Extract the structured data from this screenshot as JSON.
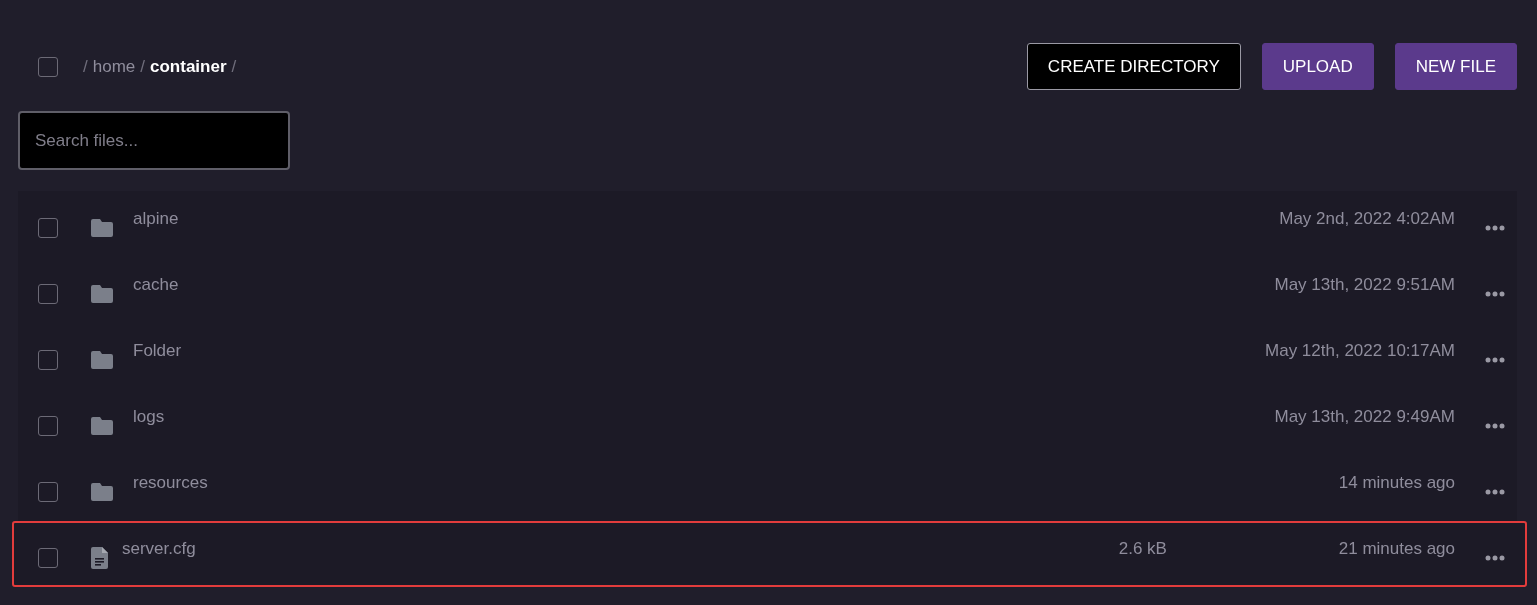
{
  "breadcrumb": {
    "checked": false,
    "separators": [
      "/",
      "/",
      "/"
    ],
    "segments": [
      {
        "label": "home",
        "current": false
      },
      {
        "label": "container",
        "current": true
      }
    ]
  },
  "buttons": [
    {
      "label": "CREATE DIRECTORY",
      "kind": "outline"
    },
    {
      "label": "UPLOAD",
      "kind": "primary"
    },
    {
      "label": "NEW FILE",
      "kind": "primary"
    }
  ],
  "search": {
    "placeholder": "Search files..."
  },
  "files": [
    {
      "name": "alpine",
      "kind": "folder",
      "modified": "May 2nd, 2022 4:02AM",
      "checked": false,
      "highlighted": false
    },
    {
      "name": "cache",
      "kind": "folder",
      "modified": "May 13th, 2022 9:51AM",
      "checked": false,
      "highlighted": false
    },
    {
      "name": "Folder",
      "kind": "folder",
      "modified": "May 12th, 2022 10:17AM",
      "checked": false,
      "highlighted": false
    },
    {
      "name": "logs",
      "kind": "folder",
      "modified": "May 13th, 2022 9:49AM",
      "checked": false,
      "highlighted": false
    },
    {
      "name": "resources",
      "kind": "folder",
      "modified": "14 minutes ago",
      "checked": false,
      "highlighted": false
    },
    {
      "name": "server.cfg",
      "kind": "file",
      "size": "2.6 kB",
      "modified": "21 minutes ago",
      "checked": false,
      "highlighted": true
    }
  ]
}
